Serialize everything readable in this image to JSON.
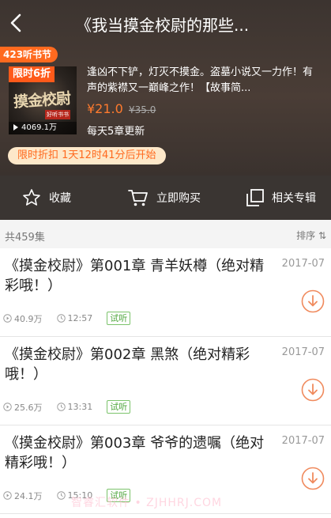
{
  "header": {
    "title": "《我当摸金校尉的那些...",
    "promo_badge": "423听书节",
    "cover": {
      "discount": "限时6折",
      "art_text": "摸金校尉",
      "tag": "好听书书",
      "plays": "4069.1万"
    },
    "description": "逢凶不下铲，灯灭不摸金。盗墓小说又一力作！有声的紫襟又一巅峰之作！【故事简...",
    "price": "¥21.0",
    "original_price": "¥35.0",
    "update": "每天5章更新",
    "countdown": "限时折扣 1天12时41分后开始"
  },
  "actions": [
    {
      "label": "收藏",
      "icon": "star-icon"
    },
    {
      "label": "立即购买",
      "icon": "cart-icon"
    },
    {
      "label": "相关专辑",
      "icon": "album-icon"
    }
  ],
  "list": {
    "count": "共459集",
    "sort_label": "排序",
    "items": [
      {
        "title": "《摸金校尉》第001章 青羊妖樽（绝对精彩哦！）",
        "date": "2017-07",
        "plays": "40.9万",
        "duration": "12:57",
        "trial": "试听"
      },
      {
        "title": "《摸金校尉》第002章 黑煞（绝对精彩哦！）",
        "date": "2017-07",
        "plays": "25.6万",
        "duration": "13:31",
        "trial": "试听"
      },
      {
        "title": "《摸金校尉》第003章 爷爷的遗嘱（绝对精彩哦！）",
        "date": "2017-07",
        "plays": "24.1万",
        "duration": "15:10",
        "trial": "试听"
      }
    ]
  },
  "watermark": "智睿汇软件 • ZJHHRJ.COM",
  "colors": {
    "accent": "#ff6a1f",
    "header_bg": "#3c3430",
    "trial_green": "#4fa63d",
    "download_orange": "#f08a5d"
  }
}
